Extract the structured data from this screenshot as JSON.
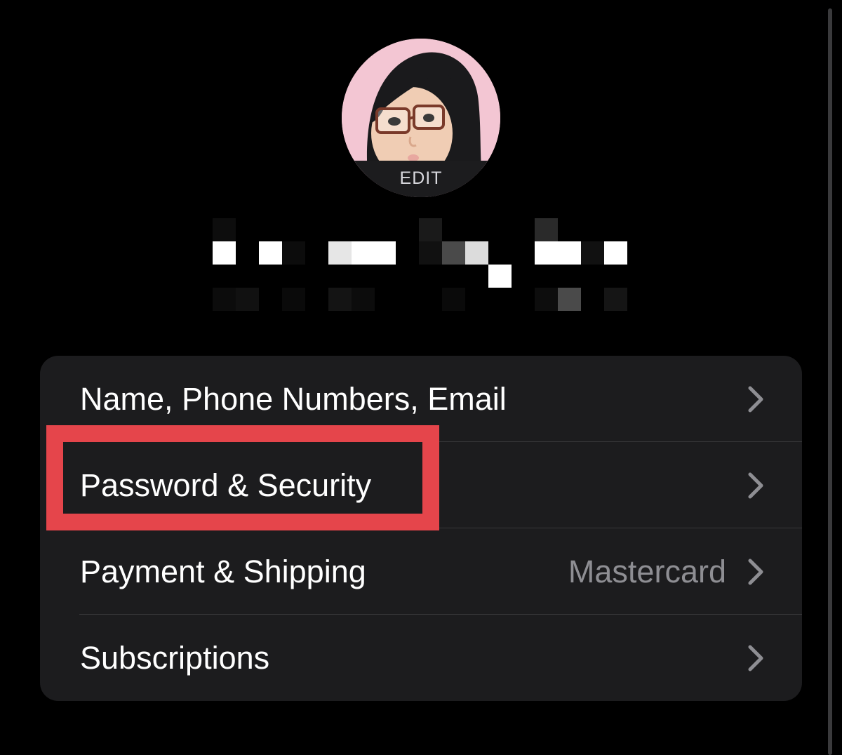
{
  "avatar": {
    "edit_label": "EDIT",
    "background_color": "#f3c6d3"
  },
  "profile": {
    "name_redacted": true
  },
  "settings": {
    "rows": [
      {
        "label": "Name, Phone Numbers, Email",
        "value": "",
        "icon": "chevron-right-icon"
      },
      {
        "label": "Password & Security",
        "value": "",
        "icon": "chevron-right-icon"
      },
      {
        "label": "Payment & Shipping",
        "value": "Mastercard",
        "icon": "chevron-right-icon"
      },
      {
        "label": "Subscriptions",
        "value": "",
        "icon": "chevron-right-icon"
      }
    ]
  },
  "annotation": {
    "highlight_color": "#e5454b",
    "highlighted_row": "Password & Security"
  },
  "colors": {
    "background": "#000000",
    "group_background": "#1c1c1e",
    "secondary_text": "#8e8e93",
    "chevron": "#8e8e93"
  }
}
